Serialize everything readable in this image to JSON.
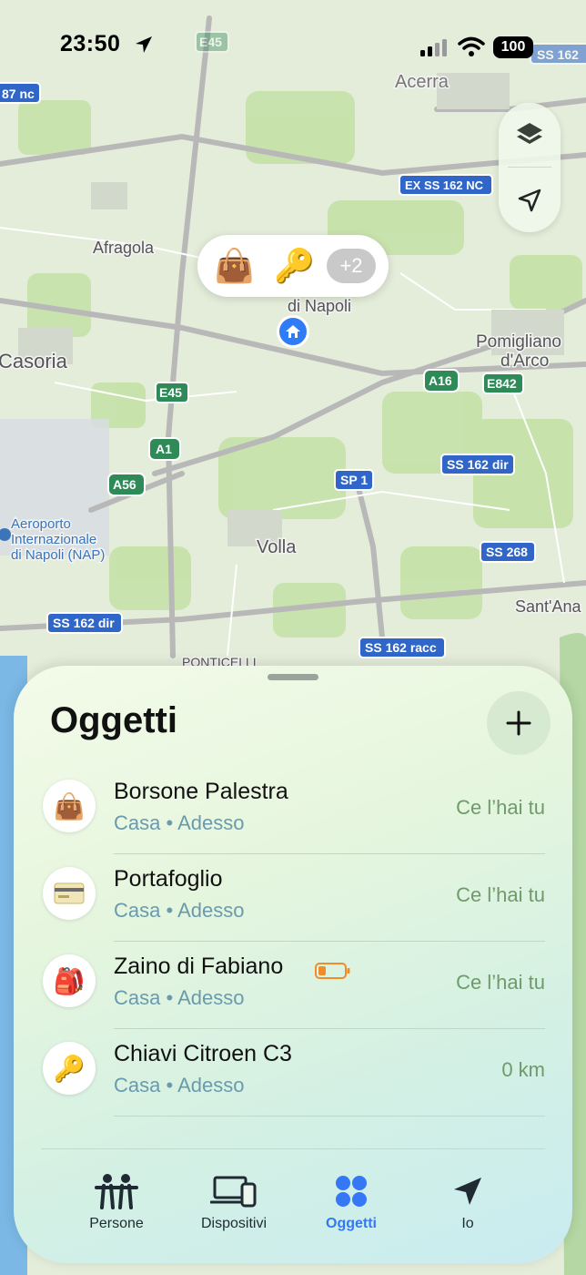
{
  "status_bar": {
    "time": "23:50",
    "battery": "100"
  },
  "map": {
    "labels": {
      "acerra": "Acerra",
      "afragola": "Afragola",
      "casoria": "Casoria",
      "pomigliano1": "Pomigliano",
      "pomigliano2": "d'Arco",
      "volla": "Volla",
      "santana": "Sant'Ana",
      "ponticelli": "PONTICELLI",
      "airport1": "Aeroporto",
      "airport2": "Internazionale",
      "airport3": "di Napoli (NAP)",
      "napoli": "di Napoli"
    },
    "road_badges": {
      "e45_top": "E45",
      "ss162_tr": "SS 162",
      "r87nc": "87 nc",
      "ex_ss162nc": "EX SS 162 NC",
      "a16": "A16",
      "e842": "E842",
      "e45": "E45",
      "a1": "A1",
      "a56": "A56",
      "sp1": "SP 1",
      "ss162dir_r": "SS 162 dir",
      "ss268": "SS 268",
      "ss162dir_l": "SS 162 dir",
      "ss162racc": "SS 162 racc"
    },
    "callout_more": "+2"
  },
  "sheet": {
    "title": "Oggetti",
    "items": [
      {
        "name": "Borsone Palestra",
        "sub": "Casa • Adesso",
        "status": "Ce l’hai tu",
        "icon": "handbag-icon"
      },
      {
        "name": "Portafoglio",
        "sub": "Casa • Adesso",
        "status": "Ce l’hai tu",
        "icon": "credit-card-icon"
      },
      {
        "name": "Zaino di Fabiano",
        "sub": "Casa • Adesso",
        "status": "Ce l’hai tu",
        "icon": "backpack-icon",
        "low_battery": true
      },
      {
        "name": "Chiavi Citroen C3",
        "sub": "Casa • Adesso",
        "status": "0 km",
        "icon": "key-icon"
      }
    ]
  },
  "tabs": [
    {
      "label": "Persone",
      "icon": "people-icon"
    },
    {
      "label": "Dispositivi",
      "icon": "devices-icon"
    },
    {
      "label": "Oggetti",
      "icon": "items-icon",
      "active": true
    },
    {
      "label": "Io",
      "icon": "location-arrow-icon"
    }
  ],
  "colors": {
    "accent": "#3478f6",
    "status_green": "#6f9a6a",
    "sub_blue": "#6a9aac"
  }
}
